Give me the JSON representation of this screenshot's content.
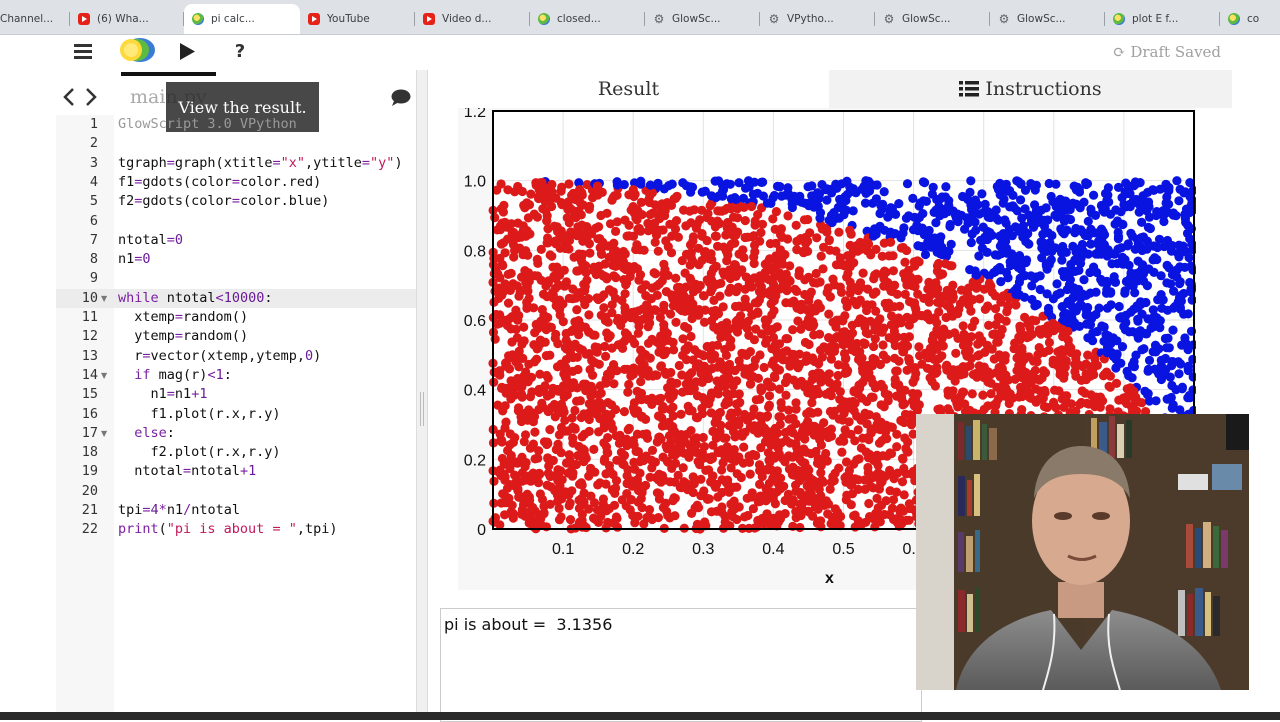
{
  "browser": {
    "tabs": [
      {
        "label": "Channel...",
        "icon": "none",
        "active": false
      },
      {
        "label": "(6) Wha...",
        "icon": "youtube-icon",
        "active": false
      },
      {
        "label": "pi calc...",
        "icon": "glowscript-icon",
        "active": true
      },
      {
        "label": "YouTube",
        "icon": "youtube-icon",
        "active": false
      },
      {
        "label": "Video d...",
        "icon": "youtube-icon",
        "active": false
      },
      {
        "label": "closed...",
        "icon": "glowscript-icon",
        "active": false
      },
      {
        "label": "GlowSc...",
        "icon": "gear-icon",
        "active": false
      },
      {
        "label": "VPytho...",
        "icon": "gear-icon",
        "active": false
      },
      {
        "label": "GlowSc...",
        "icon": "gear-icon",
        "active": false
      },
      {
        "label": "GlowSc...",
        "icon": "gear-icon",
        "active": false
      },
      {
        "label": "plot E f...",
        "icon": "glowscript-icon",
        "active": false
      },
      {
        "label": "co",
        "icon": "glowscript-icon",
        "active": false
      }
    ]
  },
  "toolbar": {
    "menu_icon": "hamburger-icon",
    "run_icon": "play-icon",
    "help_label": "?",
    "draft_status": "Draft Saved"
  },
  "editor": {
    "filename": "main.py",
    "tooltip": "View the result.",
    "lines": [
      {
        "n": "1",
        "text": "GlowScript 3.0 VPython"
      },
      {
        "n": "2",
        "text": ""
      },
      {
        "n": "3",
        "text": "tgraph=graph(xtitle=\"x\",ytitle=\"y\")"
      },
      {
        "n": "4",
        "text": "f1=gdots(color=color.red)"
      },
      {
        "n": "5",
        "text": "f2=gdots(color=color.blue)"
      },
      {
        "n": "6",
        "text": ""
      },
      {
        "n": "7",
        "text": "ntotal=0"
      },
      {
        "n": "8",
        "text": "n1=0"
      },
      {
        "n": "9",
        "text": ""
      },
      {
        "n": "10",
        "text": "while ntotal<10000:"
      },
      {
        "n": "11",
        "text": "  xtemp=random()"
      },
      {
        "n": "12",
        "text": "  ytemp=random()"
      },
      {
        "n": "13",
        "text": "  r=vector(xtemp,ytemp,0)"
      },
      {
        "n": "14",
        "text": "  if mag(r)<1:"
      },
      {
        "n": "15",
        "text": "    n1=n1+1"
      },
      {
        "n": "16",
        "text": "    f1.plot(r.x,r.y)"
      },
      {
        "n": "17",
        "text": "  else:"
      },
      {
        "n": "18",
        "text": "    f2.plot(r.x,r.y)"
      },
      {
        "n": "19",
        "text": "  ntotal=ntotal+1"
      },
      {
        "n": "20",
        "text": ""
      },
      {
        "n": "21",
        "text": "tpi=4*n1/ntotal"
      },
      {
        "n": "22",
        "text": "print(\"pi is about = \",tpi)"
      }
    ]
  },
  "result": {
    "tab_result": "Result",
    "tab_instructions": "Instructions",
    "output_text": "pi is about =  3.1356"
  },
  "chart_data": {
    "type": "scatter",
    "xlabel": "x",
    "ylabel": "y",
    "xlim": [
      0,
      1
    ],
    "ylim": [
      0,
      1.2
    ],
    "x_ticks": [
      "0.1",
      "0.2",
      "0.3",
      "0.4",
      "0.5",
      "0.6"
    ],
    "y_ticks": [
      "0",
      "0.2",
      "0.4",
      "0.6",
      "0.8",
      "1.0",
      "1.2"
    ],
    "grid": true,
    "series": [
      {
        "rule": "x^2+y^2 < 1",
        "color": "#dd1a1a"
      },
      {
        "rule": "x^2+y^2 >= 1",
        "color": "#0a14e0"
      }
    ]
  },
  "colors": {
    "red_dots": "#dd1a1a",
    "blue_dots": "#0a14e0",
    "keyword": "#7a1fa2",
    "string": "#c2185b"
  }
}
